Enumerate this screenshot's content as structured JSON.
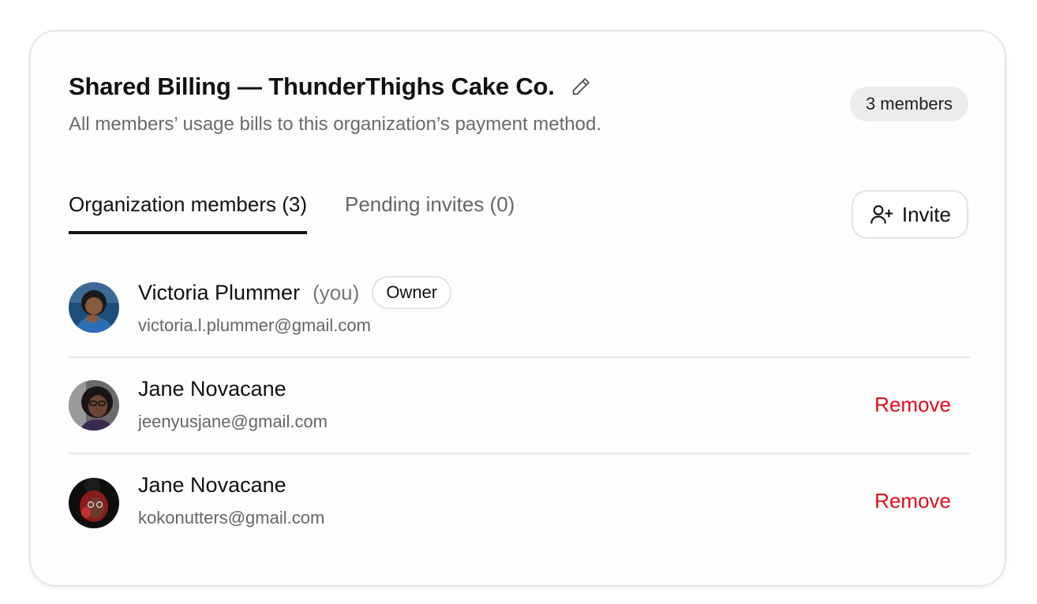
{
  "header": {
    "title": "Shared Billing — ThunderThighs Cake Co.",
    "subtitle": "All members’ usage bills to this organization’s payment method.",
    "members_badge": "3 members",
    "edit_icon": "pencil-icon"
  },
  "tabs": [
    {
      "label": "Organization members (3)",
      "active": true
    },
    {
      "label": "Pending invites (0)",
      "active": false
    }
  ],
  "invite_button": {
    "label": "Invite",
    "icon": "user-plus-icon"
  },
  "members": [
    {
      "name": "Victoria Plummer",
      "you_label": "(you)",
      "role_badge": "Owner",
      "email": "victoria.l.plummer@gmail.com"
    },
    {
      "name": "Jane Novacane",
      "email": "jeenyusjane@gmail.com",
      "action": "Remove"
    },
    {
      "name": "Jane Novacane",
      "email": "kokonutters@gmail.com",
      "action": "Remove"
    }
  ],
  "colors": {
    "remove": "#e00b1c",
    "badge_bg": "#ececec",
    "border": "#e6e6e6"
  }
}
